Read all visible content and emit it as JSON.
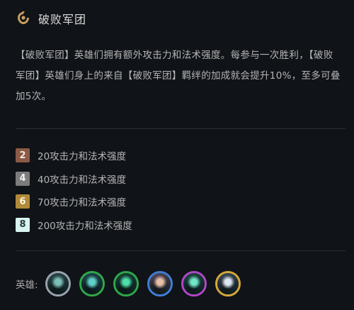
{
  "trait": {
    "title": "破败军团",
    "description": "【破败军团】英雄们拥有额外攻击力和法术强度。每参与一次胜利，【破败军团】英雄们身上的来自【破败军团】羁绊的加成就会提升10%，至多可叠加5次。"
  },
  "tiers": [
    {
      "count": "2",
      "text": "20攻击力和法术强度",
      "color": "#8b5a45",
      "text_color": "#f0e6de"
    },
    {
      "count": "4",
      "text": "40攻击力和法术强度",
      "color": "#7c7c7c",
      "text_color": "#f0f0f0"
    },
    {
      "count": "6",
      "text": "70攻击力和法术强度",
      "color": "#b08a38",
      "text_color": "#fff6dc"
    },
    {
      "count": "8",
      "text": "200攻击力和法术强度",
      "color": "#d8f5f1",
      "text_color": "#2a3a3a"
    }
  ],
  "heroes": {
    "label": "英雄:",
    "items": [
      {
        "name": "hero-1",
        "border": "#9aa3ad",
        "bg": "#2c4a4c",
        "accent": "#7ec0b8"
      },
      {
        "name": "hero-2",
        "border": "#2fa84a",
        "bg": "#1e4a52",
        "accent": "#5fd0c8"
      },
      {
        "name": "hero-3",
        "border": "#2fa84a",
        "bg": "#17463a",
        "accent": "#4ee0a8"
      },
      {
        "name": "hero-4",
        "border": "#3f7fd8",
        "bg": "#5a4a5a",
        "accent": "#e8c0a8"
      },
      {
        "name": "hero-5",
        "border": "#b247c6",
        "bg": "#1e4a44",
        "accent": "#6fe6c8"
      },
      {
        "name": "hero-6",
        "border": "#d8a93a",
        "bg": "#3a4a5a",
        "accent": "#dfe8f0"
      }
    ]
  },
  "colors": {
    "background": "#101317",
    "divider": "#2b2f35",
    "trait_icon": "#c8a060"
  }
}
